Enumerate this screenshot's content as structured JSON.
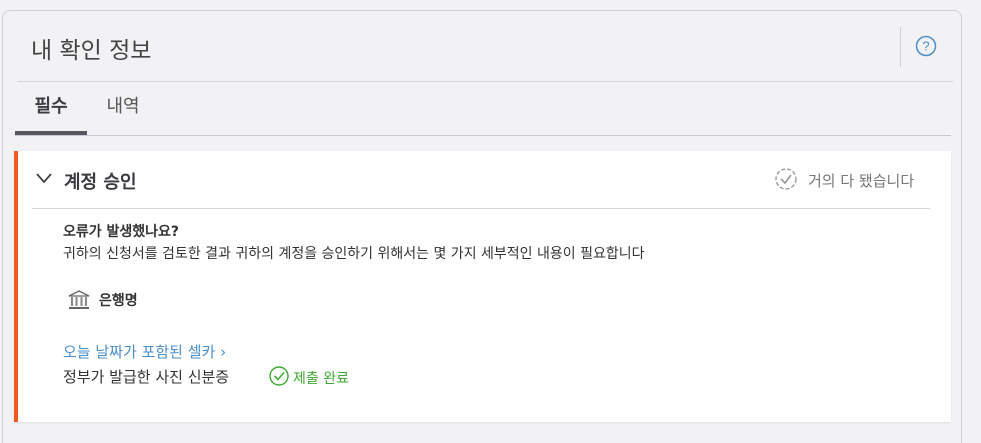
{
  "header": {
    "title": "내 확인 정보",
    "help_icon": "question-circle-icon"
  },
  "tabs": [
    {
      "label": "필수",
      "active": true
    },
    {
      "label": "내역",
      "active": false
    }
  ],
  "card": {
    "title": "계정 승인",
    "status": "거의 다 됐습니다",
    "question_title": "오류가 발생했나요?",
    "question_desc": "귀하의 신청서를 검토한 결과 귀하의 계정을 승인하기 위해서는 몇 가지 세부적인 내용이 필요합니다",
    "bank_label": "은행명",
    "selfie_link": "오늘 날짜가 포함된 셀카 ›",
    "id_label": "정부가 발급한 사진 신분증",
    "id_status": "제출 완료"
  },
  "colors": {
    "accent_bar": "#f05a1e",
    "link": "#4a8fc7",
    "success": "#3faa33"
  }
}
